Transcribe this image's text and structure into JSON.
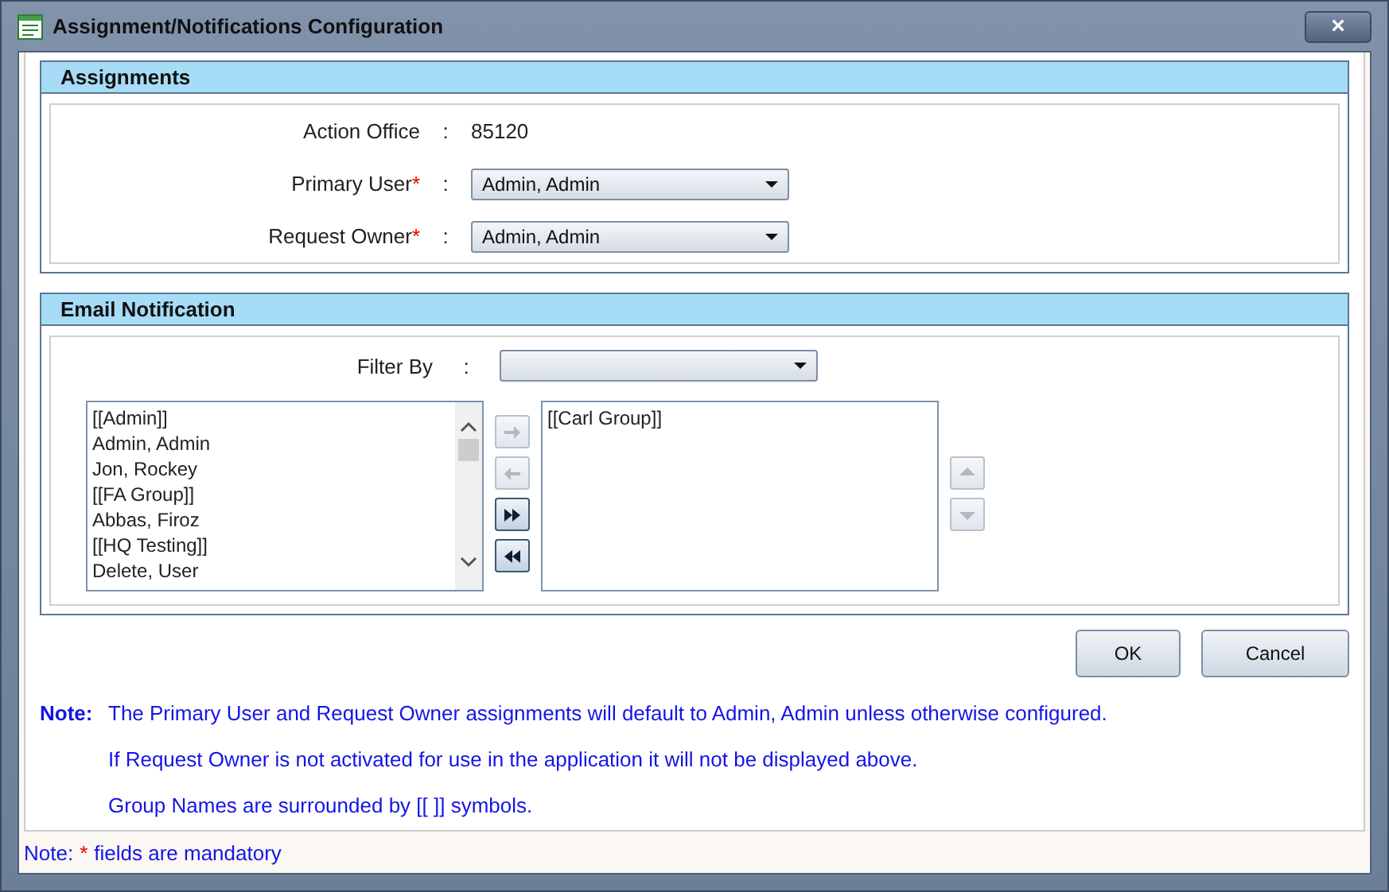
{
  "window": {
    "title": "Assignment/Notifications Configuration",
    "close": "×"
  },
  "assignments": {
    "title": "Assignments",
    "fields": [
      {
        "label": "Action Office",
        "separator": ":",
        "kind": "text",
        "value": "85120",
        "required": false
      },
      {
        "label": "Primary User",
        "separator": ":",
        "kind": "select",
        "value": "Admin, Admin",
        "required": true
      },
      {
        "label": "Request Owner",
        "separator": ":",
        "kind": "select",
        "value": "Admin, Admin",
        "required": true
      }
    ]
  },
  "email": {
    "title": "Email Notification",
    "filter": {
      "label": "Filter By",
      "separator": ":"
    },
    "available": [
      "[[Admin]]",
      "Admin, Admin",
      "Jon, Rockey",
      "[[FA Group]]",
      "Abbas, Firoz",
      "[[HQ Testing]]",
      "Delete, User"
    ],
    "move_buttons": [
      {
        "kind": "right",
        "disabled": true
      },
      {
        "kind": "left",
        "disabled": true
      },
      {
        "kind": "all-right",
        "disabled": false
      },
      {
        "kind": "all-left",
        "disabled": false
      }
    ],
    "selected": [
      "[[Carl Group]]"
    ],
    "order_buttons": [
      {
        "kind": "up",
        "disabled": true
      },
      {
        "kind": "down",
        "disabled": true
      }
    ]
  },
  "buttons": [
    "OK",
    "Cancel"
  ],
  "note": {
    "label": "Note:",
    "lines": [
      "The Primary User and Request Owner assignments will default to Admin, Admin unless otherwise configured.",
      "If Request Owner is not activated for use in the application it will not be displayed above.",
      "Group Names are surrounded by [[ ]] symbols."
    ]
  },
  "footer": {
    "label": "Note:",
    "mark": "*",
    "text": "fields are mandatory"
  }
}
